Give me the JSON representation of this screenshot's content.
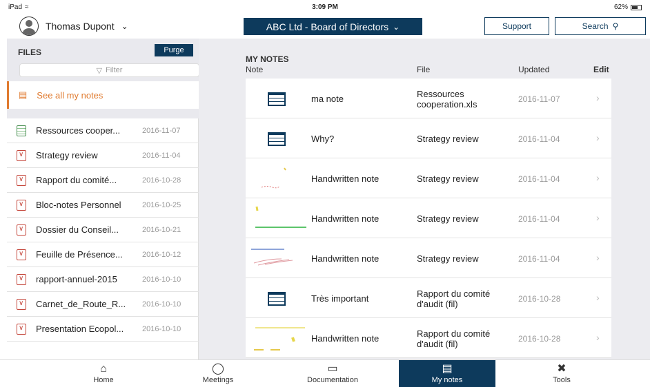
{
  "status": {
    "device": "iPad",
    "time": "3:09 PM",
    "battery": "62%"
  },
  "header": {
    "user_name": "Thomas Dupont",
    "board": "ABC Ltd - Board of Directors",
    "support_label": "Support",
    "search_label": "Search"
  },
  "sidebar": {
    "title": "FILES",
    "purge_label": "Purge",
    "filter_placeholder": "Filter",
    "see_all_label": "See all my notes",
    "files": [
      {
        "name": "Ressources cooper...",
        "date": "2016-11-07",
        "type": "xls"
      },
      {
        "name": "Strategy review",
        "date": "2016-11-04",
        "type": "pdf"
      },
      {
        "name": "Rapport du comité...",
        "date": "2016-10-28",
        "type": "pdf"
      },
      {
        "name": "Bloc-notes Personnel",
        "date": "2016-10-25",
        "type": "pdf"
      },
      {
        "name": "Dossier du Conseil...",
        "date": "2016-10-21",
        "type": "pdf"
      },
      {
        "name": "Feuille de Présence...",
        "date": "2016-10-12",
        "type": "pdf"
      },
      {
        "name": "rapport-annuel-2015",
        "date": "2016-10-10",
        "type": "pdf"
      },
      {
        "name": "Carnet_de_Route_R...",
        "date": "2016-10-10",
        "type": "pdf"
      },
      {
        "name": "Presentation Ecopol...",
        "date": "2016-10-10",
        "type": "pdf"
      }
    ]
  },
  "main": {
    "section_title": "MY NOTES",
    "columns": {
      "note": "Note",
      "file": "File",
      "updated": "Updated",
      "edit": "Edit"
    },
    "notes": [
      {
        "title": "ma note",
        "file": "Ressources cooperation.xls",
        "date": "2016-11-07",
        "kind": "typed"
      },
      {
        "title": "Why?",
        "file": "Strategy review",
        "date": "2016-11-04",
        "kind": "typed"
      },
      {
        "title": "Handwritten note",
        "file": "Strategy review",
        "date": "2016-11-04",
        "kind": "handwritten"
      },
      {
        "title": "Handwritten note",
        "file": "Strategy review",
        "date": "2016-11-04",
        "kind": "handwritten"
      },
      {
        "title": "Handwritten note",
        "file": "Strategy review",
        "date": "2016-11-04",
        "kind": "handwritten"
      },
      {
        "title": "Très important",
        "file": "Rapport du comité d'audit (fil)",
        "date": "2016-10-28",
        "kind": "typed"
      },
      {
        "title": "Handwritten note",
        "file": "Rapport du comité d'audit (fil)",
        "date": "2016-10-28",
        "kind": "handwritten"
      }
    ]
  },
  "tabs": [
    {
      "label": "Home",
      "icon": "home-icon",
      "active": false
    },
    {
      "label": "Meetings",
      "icon": "people-icon",
      "active": false
    },
    {
      "label": "Documentation",
      "icon": "folder-icon",
      "active": false
    },
    {
      "label": "My notes",
      "icon": "notes-icon",
      "active": true
    },
    {
      "label": "Tools",
      "icon": "tools-icon",
      "active": false
    }
  ],
  "colors": {
    "brand": "#0d3a5c",
    "accent": "#e07b30"
  }
}
